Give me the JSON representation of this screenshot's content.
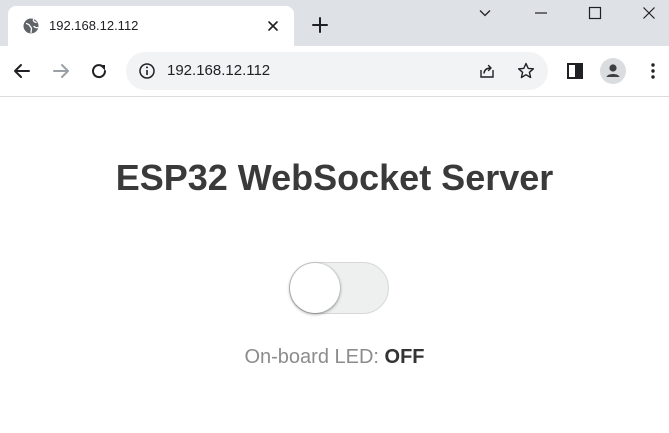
{
  "browser": {
    "tab": {
      "title": "192.168.12.112",
      "favicon": "globe-icon",
      "close_icon": "close-icon"
    },
    "new_tab_icon": "plus-icon",
    "window_controls": [
      "chevron-down-icon",
      "minimize-icon",
      "maximize-icon",
      "close-icon"
    ],
    "toolbar": {
      "back_icon": "arrow-left-icon",
      "forward_icon": "arrow-right-icon",
      "reload_icon": "reload-icon",
      "omnibox": {
        "security_icon": "info-icon",
        "url": "192.168.12.112",
        "share_icon": "share-icon",
        "bookmark_icon": "star-icon"
      },
      "side_panel_icon": "side-panel-icon",
      "profile_icon": "avatar-icon",
      "menu_icon": "kebab-menu-icon"
    }
  },
  "page": {
    "title": "ESP32 WebSocket Server",
    "toggle": {
      "checked": false
    },
    "state_label": "On-board LED: ",
    "state_value": "OFF"
  },
  "colors": {
    "tabstrip": "#dee1e6",
    "omnibox": "#f1f3f4",
    "title_text": "#3a3a3a",
    "label_text": "#8c8c8c",
    "value_text": "#333333",
    "switch_track": "#eef0f0"
  }
}
